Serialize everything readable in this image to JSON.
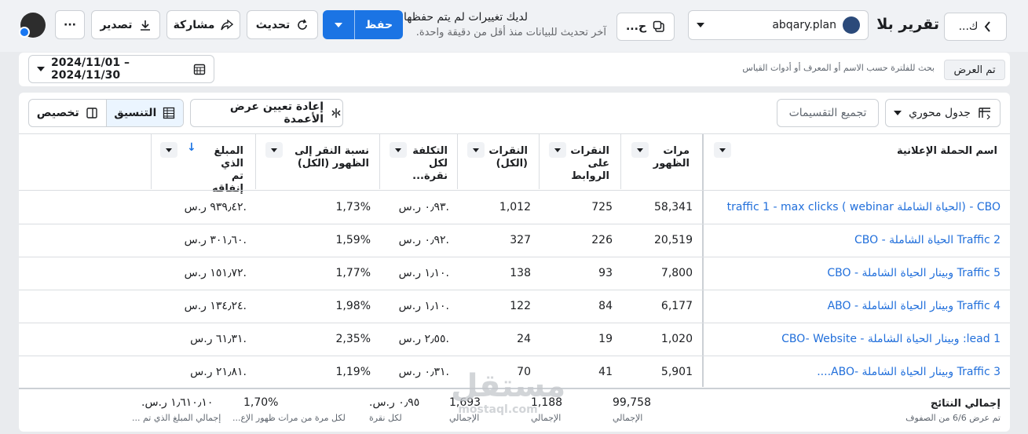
{
  "header": {
    "back_label": "ك...",
    "report_title": "تقرير بلا",
    "account_name": "abqary.plan",
    "compare_label": "ح...",
    "unsaved_title": "لديك تغييرات لم يتم حفظها",
    "unsaved_subtitle": "آخر تحديث للبيانات منذ أقل من دقيقة واحدة.",
    "save_label": "حفظ",
    "refresh_label": "تحديث",
    "share_label": "مشاركة",
    "export_label": "تصدير",
    "more_label": "···"
  },
  "filter": {
    "view_badge": "تم العرض",
    "search_placeholder": "بحث للفلترة حسب الاسم أو المعرف أو أدوات القياس",
    "date_range": "2024/11/01 – 2024/11/30"
  },
  "toolbar": {
    "pivot_label": "جدول محوري",
    "group_label": "تجميع التقسيمات",
    "reset_columns_label": "إعادة تعيين عرض الأعمدة",
    "format_label": "التنسيق",
    "customize_label": "تخصيص"
  },
  "table": {
    "columns": {
      "name": "اسم الحملة الإعلانية",
      "impressions": "مرات الظهور",
      "link_clicks": "النقرات على الروابط",
      "clicks": "النقرات (الكل)",
      "cpc": "التكلفة لكل نقرة...",
      "ctr": "نسبة النقر إلى الظهور (الكل)",
      "spend": "المبلغ الذي تم إنفاقه"
    },
    "rows": [
      {
        "name": "CBO - (الحياة الشاملة webinar ) traffic 1 - max clicks",
        "impressions": "58,341",
        "link_clicks": "725",
        "clicks": "1,012",
        "cpc": "٠٫٩٣ ر.س.",
        "ctr": "1,73%",
        "spend": "٩٣٩٫٤٢ ر.س."
      },
      {
        "name": "Traffic 2 الحياة الشاملة - CBO",
        "impressions": "20,519",
        "link_clicks": "226",
        "clicks": "327",
        "cpc": "٠٫٩٢ ر.س.",
        "ctr": "1,59%",
        "spend": "٣٠١٫٦٠ ر.س."
      },
      {
        "name": "Traffic 5 وبينار الحياة الشاملة - CBO",
        "impressions": "7,800",
        "link_clicks": "93",
        "clicks": "138",
        "cpc": "١٫١٠ ر.س.",
        "ctr": "1,77%",
        "spend": "١٥١٫٧٢ ر.س."
      },
      {
        "name": "Traffic 4 وبينار الحياة الشاملة - ABO",
        "impressions": "6,177",
        "link_clicks": "84",
        "clicks": "122",
        "cpc": "١٫١٠ ر.س.",
        "ctr": "1,98%",
        "spend": "١٣٤٫٢٤ ر.س."
      },
      {
        "name": "lead 1: وبينار الحياة الشاملة - CBO- Website",
        "impressions": "1,020",
        "link_clicks": "19",
        "clicks": "24",
        "cpc": "٢٫٥٥ ر.س.",
        "ctr": "2,35%",
        "spend": "٦١٫٣١ ر.س."
      },
      {
        "name": "Traffic 3 وبينار الحياة الشاملة -ABO....",
        "impressions": "5,901",
        "link_clicks": "41",
        "clicks": "70",
        "cpc": "٠٫٣١ ر.س.",
        "ctr": "1,19%",
        "spend": "٢١٫٨١ ر.س."
      }
    ],
    "totals": {
      "label": "إجمالي النتائج",
      "sublabel": "تم عرض 6/6 من الصفوف",
      "impressions": "99,758",
      "impressions_sub": "الإجمالي",
      "link_clicks": "1,188",
      "link_clicks_sub": "الإجمالي",
      "clicks": "1,693",
      "clicks_sub": "الإجمالي",
      "cpc": "٠٫٩٥ ر.س.",
      "cpc_sub": "لكل نقرة",
      "ctr": "1,70%",
      "ctr_sub": "لكل مرة من مرات ظهور الإع...",
      "spend": "١٫٦١٠٫١٠ ر.س.",
      "spend_sub": "إجمالي المبلغ الذي تم ..."
    }
  },
  "watermark": {
    "line1": "مستقل",
    "line2": "mostaql.com"
  },
  "colors": {
    "accent": "#1b74e4",
    "link": "#216fdb"
  }
}
